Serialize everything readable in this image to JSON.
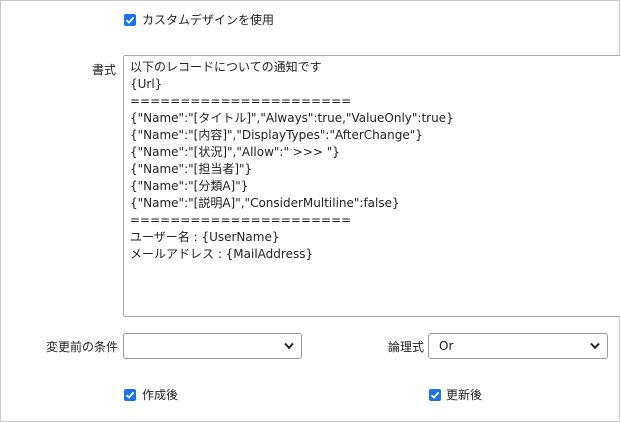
{
  "custom_design": {
    "label": "カスタムデザインを使用",
    "checked": true
  },
  "format": {
    "label": "書式",
    "lines": [
      "以下のレコードについての通知です",
      "{Url}",
      "======================",
      "{\"Name\":\"[タイトル]\",\"Always\":true,\"ValueOnly\":true}",
      "{\"Name\":\"[内容]\",\"DisplayTypes\":\"AfterChange\"}",
      "{\"Name\":\"[状況]\",\"Allow\":\" >>> \"}",
      "{\"Name\":\"[担当者]\"}",
      "{\"Name\":\"[分類A]\"}",
      "{\"Name\":\"[説明A]\",\"ConsiderMultiline\":false}",
      "======================",
      "ユーザー名 : {UserName}",
      "メールアドレス : {MailAddress}"
    ]
  },
  "before_condition": {
    "label": "変更前の条件",
    "value": ""
  },
  "logic": {
    "label": "論理式",
    "value": "Or"
  },
  "after_create": {
    "label": "作成後",
    "checked": true
  },
  "after_update": {
    "label": "更新後",
    "checked": true
  },
  "colors": {
    "accent": "#1a73e8"
  }
}
